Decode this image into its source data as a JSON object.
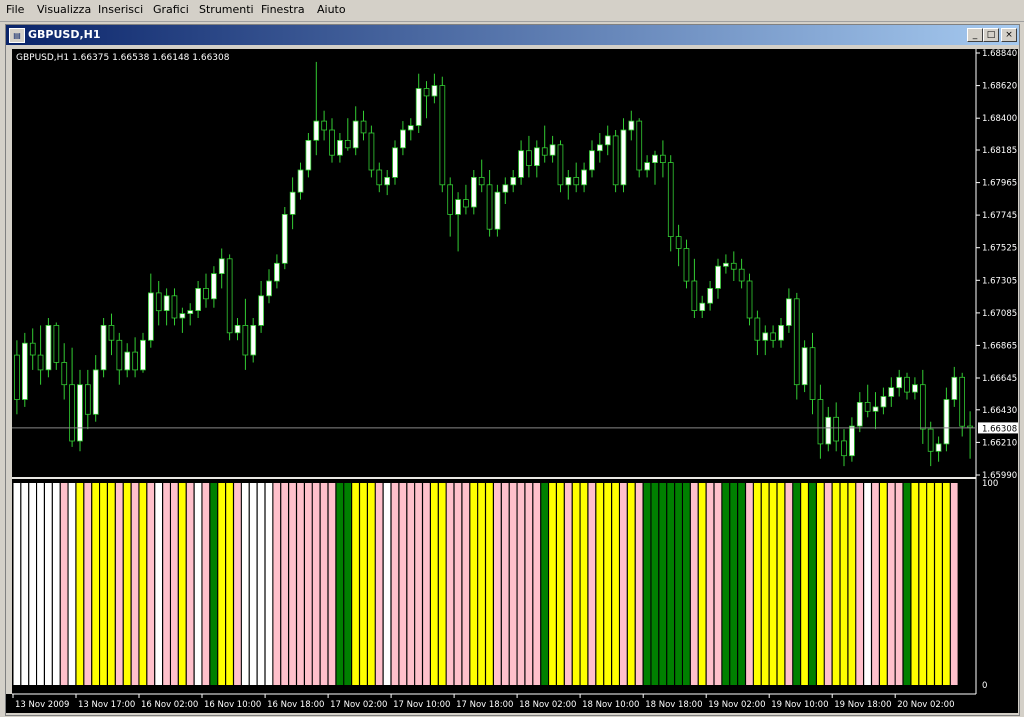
{
  "menu": [
    "File",
    "Visualizza",
    "Inserisci",
    "Grafici",
    "Strumenti",
    "Finestra",
    "Aiuto"
  ],
  "window": {
    "title": "GBPUSD,H1",
    "minimize": "_",
    "restore": "□",
    "close": "×"
  },
  "chart": {
    "info": "GBPUSD,H1  1.66375 1.66538 1.66148 1.66308",
    "current_price": "1.66308",
    "price_axis": [
      "1.68840",
      "1.68620",
      "1.68400",
      "1.68185",
      "1.67965",
      "1.67745",
      "1.67525",
      "1.67305",
      "1.67085",
      "1.66865",
      "1.66645",
      "1.66430",
      "1.66210",
      "1.65990"
    ],
    "indicator_axis": [
      "100",
      "0"
    ],
    "time_axis": [
      "13 Nov 2009",
      "13 Nov 17:00",
      "16 Nov 02:00",
      "16 Nov 10:00",
      "16 Nov 18:00",
      "17 Nov 02:00",
      "17 Nov 10:00",
      "17 Nov 18:00",
      "18 Nov 02:00",
      "18 Nov 10:00",
      "18 Nov 18:00",
      "19 Nov 02:00",
      "19 Nov 10:00",
      "19 Nov 18:00",
      "20 Nov 02:00"
    ],
    "colors": {
      "background": "#000000",
      "bull": "#ffffff",
      "bear": "#000000",
      "candle_outline": "#33cc33",
      "wick": "#33cc33",
      "price_line": "#888888",
      "white": "#ffffff",
      "yellow": "#ffff00",
      "pink": "#ffc0cb",
      "green": "#008000"
    }
  },
  "chart_data": {
    "type": "candlestick",
    "symbol": "GBPUSD",
    "timeframe": "H1",
    "ylim": [
      1.6599,
      1.6884
    ],
    "candles": [
      [
        1.668,
        1.669,
        1.664,
        1.665
      ],
      [
        1.665,
        1.6695,
        1.6645,
        1.6688
      ],
      [
        1.6688,
        1.6698,
        1.667,
        1.668
      ],
      [
        1.668,
        1.67,
        1.666,
        1.667
      ],
      [
        1.667,
        1.6705,
        1.6665,
        1.67
      ],
      [
        1.67,
        1.6702,
        1.667,
        1.6675
      ],
      [
        1.6675,
        1.6688,
        1.665,
        1.666
      ],
      [
        1.666,
        1.6685,
        1.6618,
        1.6622
      ],
      [
        1.6622,
        1.667,
        1.6615,
        1.666
      ],
      [
        1.666,
        1.667,
        1.663,
        1.664
      ],
      [
        1.664,
        1.668,
        1.6635,
        1.667
      ],
      [
        1.667,
        1.6705,
        1.6665,
        1.67
      ],
      [
        1.67,
        1.6708,
        1.668,
        1.669
      ],
      [
        1.669,
        1.6695,
        1.666,
        1.667
      ],
      [
        1.667,
        1.6688,
        1.6665,
        1.6682
      ],
      [
        1.6682,
        1.6692,
        1.6665,
        1.667
      ],
      [
        1.667,
        1.6695,
        1.6668,
        1.669
      ],
      [
        1.669,
        1.6735,
        1.6685,
        1.6722
      ],
      [
        1.6722,
        1.673,
        1.67,
        1.671
      ],
      [
        1.671,
        1.6725,
        1.67,
        1.672
      ],
      [
        1.672,
        1.6725,
        1.67,
        1.6705
      ],
      [
        1.6705,
        1.6712,
        1.6695,
        1.6708
      ],
      [
        1.6708,
        1.6715,
        1.67,
        1.671
      ],
      [
        1.671,
        1.673,
        1.6705,
        1.6725
      ],
      [
        1.6725,
        1.6735,
        1.6712,
        1.6718
      ],
      [
        1.6718,
        1.674,
        1.6712,
        1.6735
      ],
      [
        1.6735,
        1.6752,
        1.6725,
        1.6745
      ],
      [
        1.6745,
        1.6748,
        1.669,
        1.6695
      ],
      [
        1.6695,
        1.6705,
        1.669,
        1.67
      ],
      [
        1.67,
        1.6718,
        1.667,
        1.668
      ],
      [
        1.668,
        1.6705,
        1.6675,
        1.67
      ],
      [
        1.67,
        1.673,
        1.6695,
        1.672
      ],
      [
        1.672,
        1.6738,
        1.6715,
        1.673
      ],
      [
        1.673,
        1.6748,
        1.6725,
        1.6742
      ],
      [
        1.6742,
        1.678,
        1.6738,
        1.6775
      ],
      [
        1.6775,
        1.68,
        1.6765,
        1.679
      ],
      [
        1.679,
        1.681,
        1.6785,
        1.6805
      ],
      [
        1.6805,
        1.683,
        1.68,
        1.6825
      ],
      [
        1.6825,
        1.6878,
        1.6815,
        1.6838
      ],
      [
        1.6838,
        1.6845,
        1.6825,
        1.6832
      ],
      [
        1.6832,
        1.684,
        1.681,
        1.6815
      ],
      [
        1.6815,
        1.683,
        1.681,
        1.6825
      ],
      [
        1.6825,
        1.684,
        1.6818,
        1.682
      ],
      [
        1.682,
        1.6848,
        1.6815,
        1.6838
      ],
      [
        1.6838,
        1.6845,
        1.6825,
        1.683
      ],
      [
        1.683,
        1.6835,
        1.68,
        1.6805
      ],
      [
        1.6805,
        1.681,
        1.679,
        1.6795
      ],
      [
        1.6795,
        1.6805,
        1.6788,
        1.68
      ],
      [
        1.68,
        1.6825,
        1.6795,
        1.682
      ],
      [
        1.682,
        1.6838,
        1.6815,
        1.6832
      ],
      [
        1.6832,
        1.684,
        1.6825,
        1.6835
      ],
      [
        1.6835,
        1.687,
        1.683,
        1.686
      ],
      [
        1.686,
        1.6865,
        1.684,
        1.6855
      ],
      [
        1.6855,
        1.687,
        1.685,
        1.6862
      ],
      [
        1.6862,
        1.6868,
        1.679,
        1.6795
      ],
      [
        1.6795,
        1.68,
        1.676,
        1.6775
      ],
      [
        1.6775,
        1.679,
        1.675,
        1.6785
      ],
      [
        1.6785,
        1.6795,
        1.6775,
        1.678
      ],
      [
        1.678,
        1.6805,
        1.6775,
        1.68
      ],
      [
        1.68,
        1.6812,
        1.679,
        1.6795
      ],
      [
        1.6795,
        1.6805,
        1.676,
        1.6765
      ],
      [
        1.6765,
        1.6795,
        1.676,
        1.679
      ],
      [
        1.679,
        1.68,
        1.6782,
        1.6795
      ],
      [
        1.6795,
        1.6805,
        1.679,
        1.68
      ],
      [
        1.68,
        1.6825,
        1.6795,
        1.6818
      ],
      [
        1.6818,
        1.6828,
        1.68,
        1.6808
      ],
      [
        1.6808,
        1.6825,
        1.68,
        1.682
      ],
      [
        1.682,
        1.6835,
        1.681,
        1.6815
      ],
      [
        1.6815,
        1.6828,
        1.681,
        1.6822
      ],
      [
        1.6822,
        1.6825,
        1.679,
        1.6795
      ],
      [
        1.6795,
        1.6805,
        1.6785,
        1.68
      ],
      [
        1.68,
        1.681,
        1.679,
        1.6795
      ],
      [
        1.6795,
        1.681,
        1.679,
        1.6805
      ],
      [
        1.6805,
        1.6825,
        1.68,
        1.6818
      ],
      [
        1.6818,
        1.683,
        1.681,
        1.6822
      ],
      [
        1.6822,
        1.6835,
        1.6815,
        1.6828
      ],
      [
        1.6828,
        1.6832,
        1.679,
        1.6795
      ],
      [
        1.6795,
        1.684,
        1.679,
        1.6832
      ],
      [
        1.6832,
        1.6845,
        1.6825,
        1.6838
      ],
      [
        1.6838,
        1.684,
        1.68,
        1.6805
      ],
      [
        1.6805,
        1.6815,
        1.68,
        1.681
      ],
      [
        1.681,
        1.6818,
        1.6795,
        1.6815
      ],
      [
        1.6815,
        1.6825,
        1.68,
        1.681
      ],
      [
        1.681,
        1.6815,
        1.675,
        1.676
      ],
      [
        1.676,
        1.6768,
        1.674,
        1.6752
      ],
      [
        1.6752,
        1.6758,
        1.6725,
        1.673
      ],
      [
        1.673,
        1.6745,
        1.6705,
        1.671
      ],
      [
        1.671,
        1.672,
        1.6705,
        1.6715
      ],
      [
        1.6715,
        1.673,
        1.671,
        1.6725
      ],
      [
        1.6725,
        1.6745,
        1.6718,
        1.674
      ],
      [
        1.674,
        1.6748,
        1.6735,
        1.6742
      ],
      [
        1.6742,
        1.675,
        1.673,
        1.6738
      ],
      [
        1.6738,
        1.6745,
        1.6725,
        1.673
      ],
      [
        1.673,
        1.6735,
        1.67,
        1.6705
      ],
      [
        1.6705,
        1.671,
        1.668,
        1.669
      ],
      [
        1.669,
        1.67,
        1.668,
        1.6695
      ],
      [
        1.6695,
        1.67,
        1.6685,
        1.669
      ],
      [
        1.669,
        1.6705,
        1.6685,
        1.67
      ],
      [
        1.67,
        1.6725,
        1.6695,
        1.6718
      ],
      [
        1.6718,
        1.6722,
        1.665,
        1.666
      ],
      [
        1.666,
        1.669,
        1.6655,
        1.6685
      ],
      [
        1.6685,
        1.6695,
        1.664,
        1.665
      ],
      [
        1.665,
        1.666,
        1.661,
        1.662
      ],
      [
        1.662,
        1.6645,
        1.6615,
        1.6638
      ],
      [
        1.6638,
        1.6648,
        1.6615,
        1.6622
      ],
      [
        1.6622,
        1.663,
        1.6605,
        1.6612
      ],
      [
        1.6612,
        1.6638,
        1.6608,
        1.6632
      ],
      [
        1.6632,
        1.6655,
        1.6628,
        1.6648
      ],
      [
        1.6648,
        1.666,
        1.6638,
        1.6642
      ],
      [
        1.6642,
        1.6655,
        1.663,
        1.6645
      ],
      [
        1.6645,
        1.6658,
        1.664,
        1.6652
      ],
      [
        1.6652,
        1.6665,
        1.6645,
        1.6658
      ],
      [
        1.6658,
        1.667,
        1.6652,
        1.6665
      ],
      [
        1.6665,
        1.6668,
        1.665,
        1.6655
      ],
      [
        1.6655,
        1.6665,
        1.665,
        1.666
      ],
      [
        1.666,
        1.667,
        1.662,
        1.663
      ],
      [
        1.663,
        1.6635,
        1.6605,
        1.6615
      ],
      [
        1.6615,
        1.6625,
        1.6608,
        1.662
      ],
      [
        1.662,
        1.6658,
        1.6615,
        1.665
      ],
      [
        1.665,
        1.6672,
        1.6645,
        1.6665
      ],
      [
        1.6665,
        1.6668,
        1.6625,
        1.6632
      ],
      [
        1.6632,
        1.6642,
        1.661,
        1.6631
      ]
    ],
    "indicator": {
      "type": "bar",
      "ylim": [
        0,
        100
      ],
      "colors": [
        "white",
        "white",
        "white",
        "white",
        "white",
        "white",
        "pink",
        "white",
        "yellow",
        "pink",
        "yellow",
        "yellow",
        "yellow",
        "pink",
        "yellow",
        "pink",
        "yellow",
        "pink",
        "white",
        "pink",
        "pink",
        "yellow",
        "pink",
        "white",
        "pink",
        "green",
        "yellow",
        "yellow",
        "pink",
        "white",
        "white",
        "white",
        "white",
        "pink",
        "pink",
        "pink",
        "pink",
        "pink",
        "pink",
        "pink",
        "pink",
        "green",
        "green",
        "yellow",
        "yellow",
        "yellow",
        "pink",
        "white",
        "pink",
        "pink",
        "pink",
        "pink",
        "pink",
        "yellow",
        "yellow",
        "pink",
        "pink",
        "pink",
        "yellow",
        "yellow",
        "yellow",
        "pink",
        "pink",
        "pink",
        "pink",
        "pink",
        "pink",
        "green",
        "yellow",
        "yellow",
        "pink",
        "yellow",
        "yellow",
        "pink",
        "yellow",
        "yellow",
        "yellow",
        "pink",
        "yellow",
        "pink",
        "green",
        "green",
        "green",
        "green",
        "green",
        "green",
        "pink",
        "yellow",
        "pink",
        "pink",
        "green",
        "green",
        "green",
        "pink",
        "yellow",
        "yellow",
        "yellow",
        "yellow",
        "pink",
        "green",
        "yellow",
        "green",
        "yellow",
        "pink",
        "yellow",
        "yellow",
        "yellow",
        "pink",
        "white",
        "pink",
        "yellow",
        "pink",
        "pink",
        "green",
        "yellow",
        "yellow",
        "yellow",
        "yellow",
        "yellow",
        "pink"
      ]
    }
  }
}
